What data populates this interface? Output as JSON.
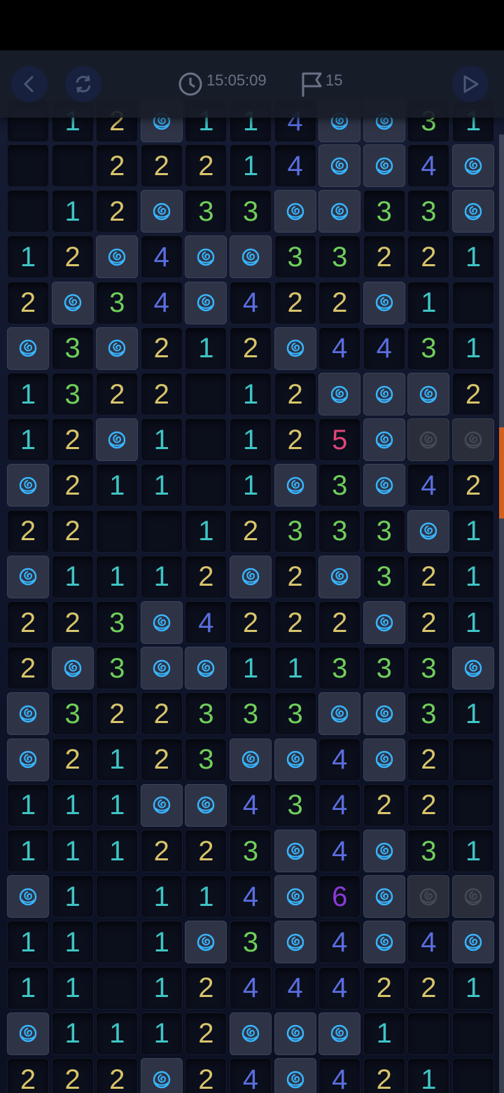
{
  "toolbar": {
    "time": "15:05:09",
    "flags": "15",
    "icons": [
      "back-icon",
      "restart-icon",
      "clock-icon",
      "flag-icon",
      "play-icon"
    ]
  },
  "colors": {
    "n1": "#3ec5c4",
    "n2": "#d7c46a",
    "n3": "#6fcf5a",
    "n4": "#5a6ee0",
    "n5": "#e0457a",
    "n6": "#8a3ad6",
    "rose": "#39b6ff",
    "accent": "#d2601e"
  },
  "board": {
    "columns": 11,
    "legend": "digits = adjacent mine count, M = revealed rose mine, H = hidden tile, blank = empty opened",
    "rows": [
      [
        "",
        "",
        "2",
        "2",
        "2",
        "1",
        "4",
        "M",
        "M",
        "4",
        "M"
      ],
      [
        "",
        "1",
        "2",
        "M",
        "3",
        "3",
        "M",
        "M",
        "3",
        "3",
        "M"
      ],
      [
        "1",
        "2",
        "M",
        "4",
        "M",
        "M",
        "3",
        "3",
        "2",
        "2",
        "1"
      ],
      [
        "2",
        "M",
        "3",
        "4",
        "M",
        "4",
        "2",
        "2",
        "M",
        "1",
        ""
      ],
      [
        "M",
        "3",
        "M",
        "2",
        "1",
        "2",
        "M",
        "4",
        "4",
        "3",
        "1"
      ],
      [
        "1",
        "3",
        "2",
        "2",
        "",
        "1",
        "2",
        "M",
        "M",
        "M",
        "2"
      ],
      [
        "1",
        "2",
        "M",
        "1",
        "",
        "1",
        "2",
        "5",
        "M",
        "H",
        "H"
      ],
      [
        "M",
        "2",
        "1",
        "1",
        "",
        "1",
        "M",
        "3",
        "M",
        "4",
        "2"
      ],
      [
        "2",
        "2",
        "",
        "",
        "1",
        "2",
        "3",
        "3",
        "3",
        "M",
        "1"
      ],
      [
        "M",
        "1",
        "1",
        "1",
        "2",
        "M",
        "2",
        "M",
        "3",
        "2",
        "1"
      ],
      [
        "2",
        "2",
        "3",
        "M",
        "4",
        "2",
        "2",
        "2",
        "M",
        "2",
        "1"
      ],
      [
        "2",
        "M",
        "3",
        "M",
        "M",
        "1",
        "1",
        "3",
        "3",
        "3",
        "M"
      ],
      [
        "M",
        "3",
        "2",
        "2",
        "3",
        "3",
        "3",
        "M",
        "M",
        "3",
        "1"
      ],
      [
        "M",
        "2",
        "1",
        "2",
        "3",
        "M",
        "M",
        "4",
        "M",
        "2",
        ""
      ],
      [
        "1",
        "1",
        "1",
        "M",
        "M",
        "4",
        "3",
        "4",
        "2",
        "2",
        ""
      ],
      [
        "1",
        "1",
        "1",
        "2",
        "2",
        "3",
        "M",
        "4",
        "M",
        "3",
        "1"
      ],
      [
        "M",
        "1",
        "",
        "1",
        "1",
        "4",
        "M",
        "6",
        "M",
        "H",
        "H"
      ],
      [
        "1",
        "1",
        "",
        "1",
        "M",
        "3",
        "M",
        "4",
        "M",
        "4",
        "M"
      ],
      [
        "1",
        "1",
        "",
        "1",
        "2",
        "4",
        "4",
        "4",
        "2",
        "2",
        "1"
      ],
      [
        "M",
        "1",
        "1",
        "1",
        "2",
        "M",
        "M",
        "M",
        "1",
        "",
        ""
      ],
      [
        "2",
        "2",
        "2",
        "M",
        "2",
        "4",
        "M",
        "4",
        "2",
        "1",
        ""
      ]
    ],
    "partial_top_row": [
      "",
      "1",
      "2",
      "M",
      "1",
      "1",
      "4",
      "M",
      "M",
      "3",
      "1"
    ]
  }
}
